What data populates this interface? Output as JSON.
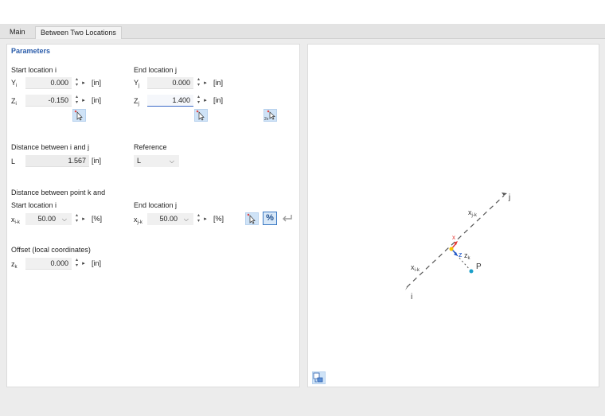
{
  "tabs": [
    {
      "label": "Main"
    },
    {
      "label": "Between Two Locations"
    }
  ],
  "parameters": {
    "heading": "Parameters",
    "start_location": {
      "title": "Start location i",
      "y_label": "Y",
      "y_sub": "i",
      "y_value": "0.000",
      "z_label": "Z",
      "z_sub": "i",
      "z_value": "-0.150",
      "unit": "[in]"
    },
    "end_location": {
      "title": "End location j",
      "y_label": "Y",
      "y_sub": "j",
      "y_value": "0.000",
      "z_label": "Z",
      "z_sub": "j",
      "z_value": "1.400",
      "unit": "[in]"
    },
    "distance": {
      "title": "Distance between i and j",
      "l_label": "L",
      "l_value": "1.567",
      "unit": "[in]"
    },
    "reference": {
      "title": "Reference",
      "value": "L"
    },
    "point_k": {
      "title": "Distance between point k and",
      "start_title": "Start location i",
      "end_title": "End location j",
      "xik_label": "x",
      "xik_sub": "i-k",
      "xik_value": "50.00",
      "xjk_label": "x",
      "xjk_sub": "j-k",
      "xjk_value": "50.00",
      "unit": "[%]",
      "percent_button": "%"
    },
    "offset": {
      "title": "Offset (local coordinates)",
      "zk_label": "z",
      "zk_sub": "k",
      "zk_value": "0.000",
      "unit": "[in]"
    }
  },
  "diagram": {
    "label_j": "j",
    "label_i": "i",
    "label_xjk": "x",
    "label_xjk_sub": "j-k",
    "label_xik": "x",
    "label_xik_sub": "i-k",
    "label_x": "x",
    "label_z": "z",
    "label_zk": "z",
    "label_zk_sub": "k",
    "label_p": "P"
  },
  "colors": {
    "heading": "#2a5caa",
    "axis_x": "#e53935",
    "axis_z": "#1e56c8",
    "point_k": "#f5c400",
    "point_p": "#1a9fc9",
    "line": "#555555"
  }
}
